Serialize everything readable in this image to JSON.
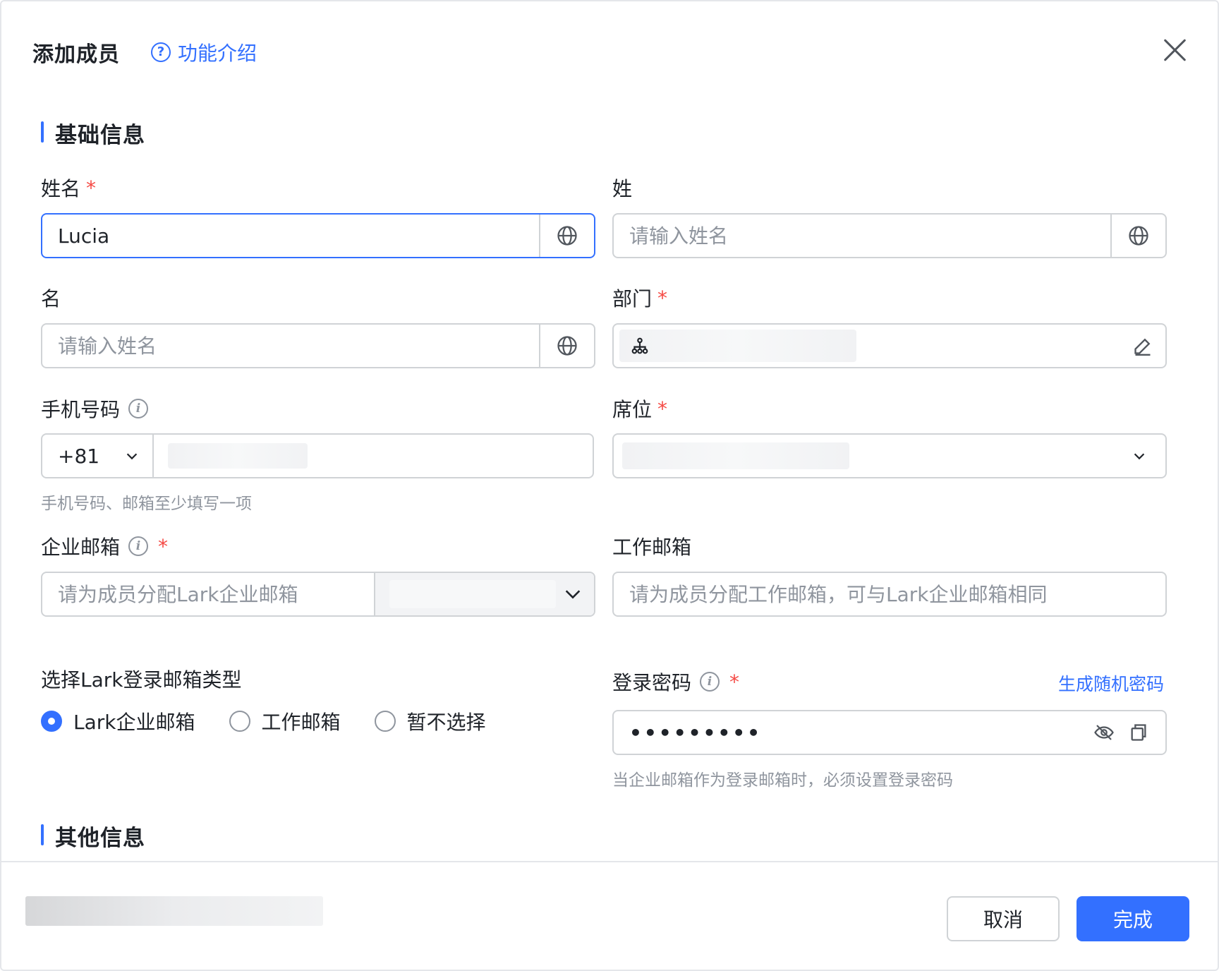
{
  "dialog": {
    "title": "添加成员",
    "help_link": "功能介绍"
  },
  "sections": {
    "basic": "基础信息",
    "other": "其他信息"
  },
  "fields": {
    "full_name": {
      "label": "姓名",
      "value": "Lucia"
    },
    "last_name": {
      "label": "姓",
      "placeholder": "请输入姓名"
    },
    "first_name": {
      "label": "名",
      "placeholder": "请输入姓名"
    },
    "department": {
      "label": "部门"
    },
    "phone": {
      "label": "手机号码",
      "country_code": "+81",
      "hint": "手机号码、邮箱至少填写一项"
    },
    "seat": {
      "label": "席位"
    },
    "enterprise_email": {
      "label": "企业邮箱",
      "placeholder": "请为成员分配Lark企业邮箱"
    },
    "work_email": {
      "label": "工作邮箱",
      "placeholder": "请为成员分配工作邮箱，可与Lark企业邮箱相同"
    },
    "login_email_type": {
      "label": "选择Lark登录邮箱类型",
      "options": [
        "Lark企业邮箱",
        "工作邮箱",
        "暂不选择"
      ],
      "selected": "Lark企业邮箱"
    },
    "password": {
      "label": "登录密码",
      "generate_link": "生成随机密码",
      "masked_value": "•••••••••",
      "hint": "当企业邮箱作为登录邮箱时，必须设置登录密码"
    }
  },
  "footer": {
    "cancel": "取消",
    "confirm": "完成"
  },
  "colors": {
    "accent": "#3370ff",
    "required": "#f54a45",
    "border": "#d0d3d6",
    "placeholder": "#8f959e"
  }
}
